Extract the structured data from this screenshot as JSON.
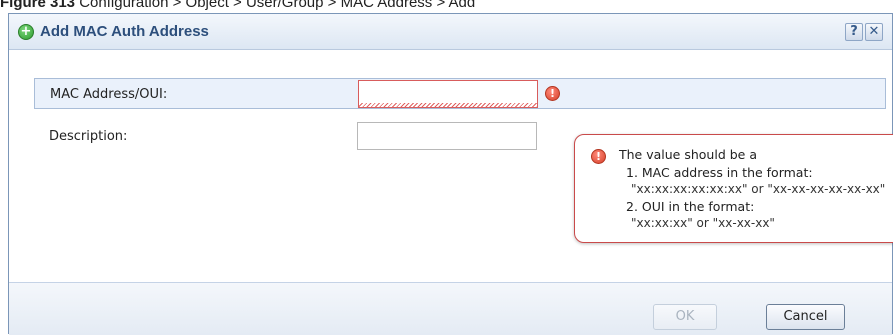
{
  "caption": {
    "figure": "Figure 313",
    "path": "Configuration > Object > User/Group > MAC Address > Add"
  },
  "dialog": {
    "title": "Add MAC Auth Address",
    "help_label": "?",
    "close_label": "✕",
    "fields": {
      "mac_label": "MAC Address/OUI:",
      "mac_value": "",
      "description_label": "Description:",
      "description_value": ""
    },
    "tooltip": {
      "line1": "The value should be a",
      "line2": "1. MAC address in the format:",
      "line3": "\"xx:xx:xx:xx:xx:xx\" or \"xx-xx-xx-xx-xx-xx\"",
      "line4": "2. OUI in the format:",
      "line5": "\"xx:xx:xx\" or \"xx-xx-xx\""
    },
    "buttons": {
      "ok": "OK",
      "cancel": "Cancel"
    }
  },
  "colors": {
    "accent": "#2d4f7c",
    "error": "#d6402a",
    "active_row": "#eaf1fb"
  },
  "icons": {
    "title": "add-circle-icon",
    "error": "error-icon"
  }
}
